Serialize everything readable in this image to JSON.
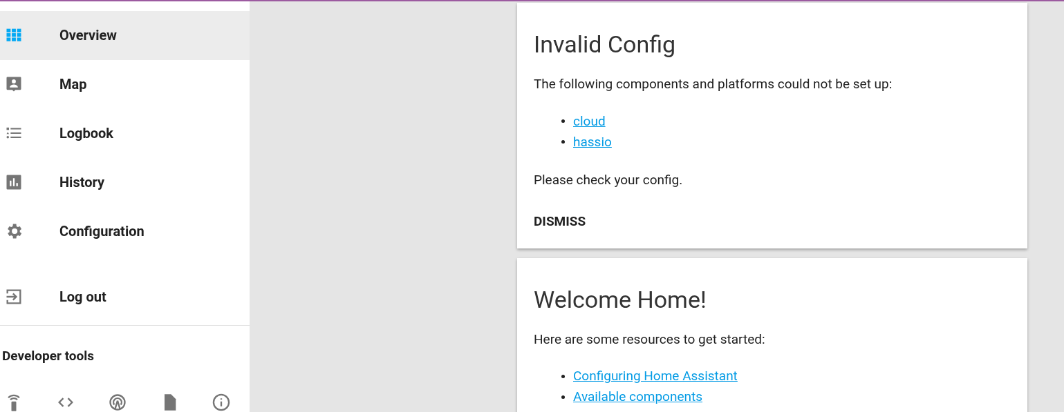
{
  "sidebar": {
    "items": [
      {
        "label": "Overview",
        "selected": true
      },
      {
        "label": "Map",
        "selected": false
      },
      {
        "label": "Logbook",
        "selected": false
      },
      {
        "label": "History",
        "selected": false
      },
      {
        "label": "Configuration",
        "selected": false
      }
    ],
    "logout": {
      "label": "Log out"
    },
    "developer_tools": {
      "title": "Developer tools"
    }
  },
  "cards": [
    {
      "title": "Invalid Config",
      "intro": "The following components and platforms could not be set up:",
      "links": [
        "cloud",
        "hassio"
      ],
      "outro": "Please check your config.",
      "action": "DISMISS"
    },
    {
      "title": "Welcome Home!",
      "intro": "Here are some resources to get started:",
      "links": [
        "Configuring Home Assistant",
        "Available components"
      ]
    }
  ]
}
